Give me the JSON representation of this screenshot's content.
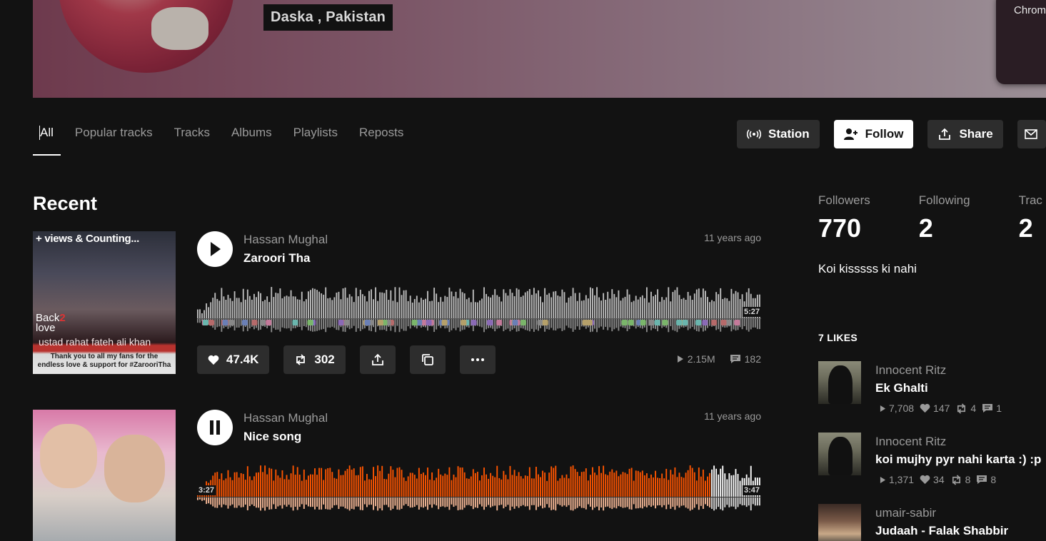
{
  "banner": {
    "location": "Daska , Pakistan",
    "popup_text": "Chrome didr"
  },
  "tabs": [
    {
      "label": "All"
    },
    {
      "label": "Popular tracks"
    },
    {
      "label": "Tracks"
    },
    {
      "label": "Albums"
    },
    {
      "label": "Playlists"
    },
    {
      "label": "Reposts"
    }
  ],
  "actions": {
    "station": "Station",
    "follow": "Follow",
    "share": "Share"
  },
  "recent": {
    "heading": "Recent",
    "tracks": [
      {
        "uploader": "Hassan Mughal",
        "title": "Zaroori Tha",
        "date": "11 years ago",
        "duration": "5:27",
        "likes": "47.4K",
        "reposts": "302",
        "plays": "2.15M",
        "comments": "182",
        "playing": false,
        "progress": 0,
        "artwork_text": {
          "top": "+ views & Counting...",
          "brand_line1": "Back",
          "brand_line2": "2",
          "brand_line3": "love",
          "singer": "ustad rahat fateh ali khan",
          "thanks": "Thank you to all my fans for the endless love & support for #ZarooriTha"
        }
      },
      {
        "uploader": "Hassan Mughal",
        "title": "Nice song",
        "date": "11 years ago",
        "duration": "3:47",
        "elapsed": "3:27",
        "playing": true,
        "progress": 0.91
      }
    ]
  },
  "sidebar": {
    "stats": [
      {
        "label": "Followers",
        "value": "770"
      },
      {
        "label": "Following",
        "value": "2"
      },
      {
        "label": "Trac",
        "value": "2"
      }
    ],
    "bio": "Koi kisssss ki nahi",
    "likes_heading": "7 LIKES",
    "likes": [
      {
        "user": "Innocent Ritz",
        "title": "Ek Ghalti",
        "plays": "7,708",
        "likes": "147",
        "reposts": "4",
        "comments": "1"
      },
      {
        "user": "Innocent Ritz",
        "title": "koi mujhy pyr nahi karta :) :p",
        "plays": "1,371",
        "likes": "34",
        "reposts": "8",
        "comments": "8"
      },
      {
        "user": "umair-sabir",
        "title": "Judaah - Falak Shabbir"
      }
    ]
  },
  "colors": {
    "accent": "#ff5500",
    "background": "#121212",
    "button": "#2d2d2d"
  }
}
